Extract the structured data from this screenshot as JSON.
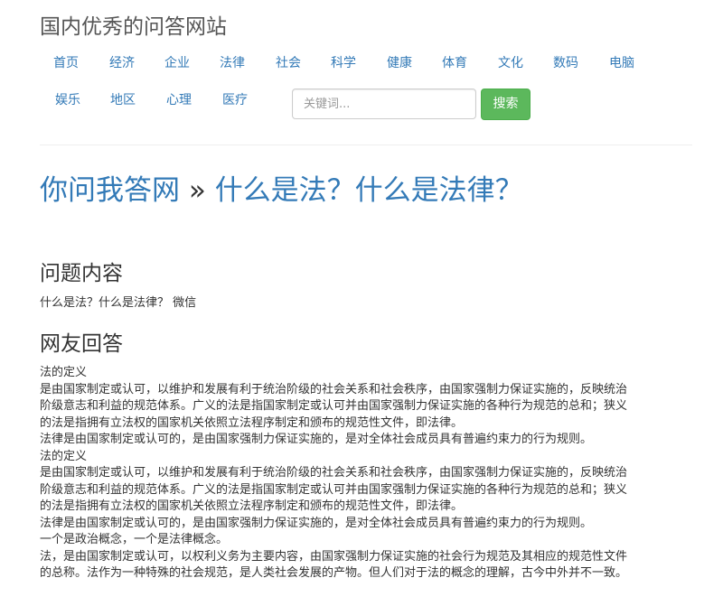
{
  "site": {
    "title": "国内优秀的问答网站"
  },
  "nav": {
    "items": [
      {
        "label": "首页"
      },
      {
        "label": "经济"
      },
      {
        "label": "企业"
      },
      {
        "label": "法律"
      },
      {
        "label": "社会"
      },
      {
        "label": "科学"
      },
      {
        "label": "健康"
      },
      {
        "label": "体育"
      },
      {
        "label": "文化"
      },
      {
        "label": "数码"
      },
      {
        "label": "电脑"
      },
      {
        "label": "娱乐"
      },
      {
        "label": "地区"
      },
      {
        "label": "心理"
      },
      {
        "label": "医疗"
      }
    ]
  },
  "search": {
    "placeholder": "关键词...",
    "value": "",
    "button_label": "搜索"
  },
  "breadcrumb": {
    "site_link": "你问我答网",
    "separator": "»",
    "question_title": "什么是法？什么是法律？"
  },
  "question": {
    "heading": "问题内容",
    "body": "什么是法？什么是法律？ 微信"
  },
  "answers": {
    "heading": "网友回答",
    "lines": [
      "法的定义",
      "是由国家制定或认可，以维护和发展有利于统治阶级的社会关系和社会秩序，由国家强制力保证实施的，反映统治",
      "阶级意志和利益的规范体系。广义的法是指国家制定或认可并由国家强制力保证实施的各种行为规范的总和；狭义",
      "的法是指拥有立法权的国家机关依照立法程序制定和颁布的规范性文件，即法律。",
      "法律是由国家制定或认可的，是由国家强制力保证实施的，是对全体社会成员具有普遍约束力的行为规则。",
      "法的定义",
      "是由国家制定或认可，以维护和发展有利于统治阶级的社会关系和社会秩序，由国家强制力保证实施的，反映统治",
      "阶级意志和利益的规范体系。广义的法是指国家制定或认可并由国家强制力保证实施的各种行为规范的总和；狭义",
      "的法是指拥有立法权的国家机关依照立法程序制定和颁布的规范性文件，即法律。",
      "法律是由国家制定或认可的，是由国家强制力保证实施的，是对全体社会成员具有普遍约束力的行为规则。",
      "一个是政治概念，一个是法律概念。",
      "法，是由国家制定或认可，以权利义务为主要内容，由国家强制力保证实施的社会行为规范及其相应的规范性文件",
      "的总称。法作为一种特殊的社会规范，是人类社会发展的产物。但人们对于法的概念的理解，古今中外并不一致。"
    ]
  },
  "colors": {
    "link": "#337ab7",
    "search_button": "#5cb85c",
    "text": "#333333",
    "site_title": "#555555"
  }
}
